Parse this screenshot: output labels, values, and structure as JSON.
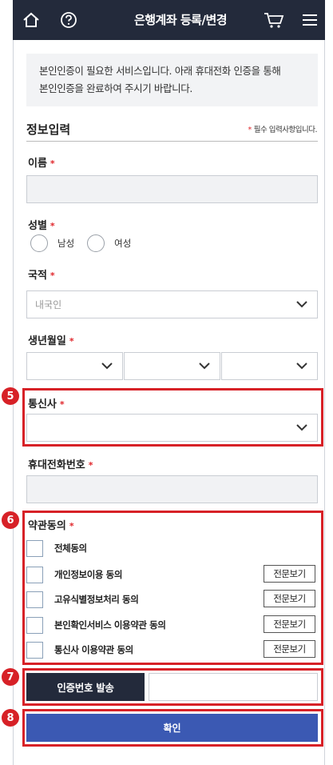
{
  "header": {
    "title": "은행계좌 등록/변경",
    "icons": [
      "home-icon",
      "help-icon",
      "cart-icon",
      "menu-icon"
    ]
  },
  "notice": {
    "line1": "본인인증이 필요한 서비스입니다. 아래 휴대전화 인증을 통해",
    "line2": "본인인증을 완료하여 주시기 바랍니다."
  },
  "form": {
    "section_title": "정보입력",
    "required_star": "*",
    "required_note": "필수 입력사항입니다.",
    "name_label": "이름",
    "gender_label": "성별",
    "gender_options": [
      "남성",
      "여성"
    ],
    "nationality_label": "국적",
    "nationality_value": "내국인",
    "birth_label": "생년월일",
    "carrier_label": "통신사",
    "phone_label": "휴대전화번호",
    "terms_label": "약관동의",
    "terms": [
      {
        "label": "전체동의",
        "has_view": false
      },
      {
        "label": "개인정보이용 동의",
        "has_view": true
      },
      {
        "label": "고유식별정보처리 동의",
        "has_view": true
      },
      {
        "label": "본인확인서비스 이용약관 동의",
        "has_view": true
      },
      {
        "label": "통신사 이용약관 동의",
        "has_view": true
      }
    ],
    "view_full_label": "전문보기",
    "send_code_label": "인증번호 발송",
    "confirm_label": "확인"
  },
  "annotations": {
    "badges": [
      "5",
      "6",
      "7",
      "8"
    ],
    "color": "#d72127"
  },
  "colors": {
    "header_bg": "#232a3b",
    "confirm_bg": "#3b59b3",
    "required": "#e0262b"
  }
}
